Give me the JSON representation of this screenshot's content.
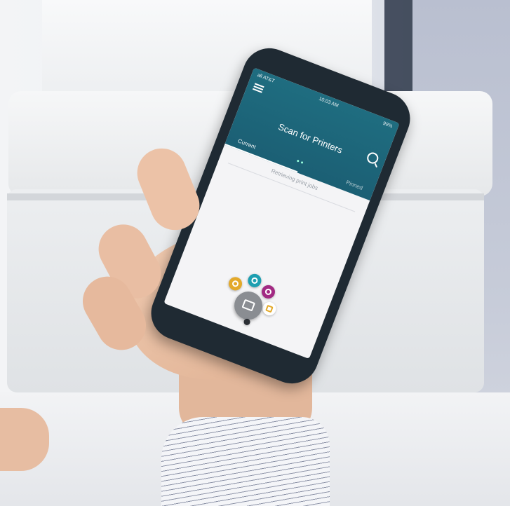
{
  "app": {
    "status": {
      "time": "10:03 AM",
      "battery": "99%",
      "signal": "all AT&T"
    },
    "title": "Scan for Printers",
    "tabs": [
      {
        "label": "Current"
      },
      {
        "label": "Pinned"
      }
    ],
    "notice": "Retrieving print jobs"
  },
  "colors": {
    "appbar": "#1f6d80",
    "fab_yellow": "#e3a92a",
    "fab_teal": "#1d9fb1",
    "fab_purple": "#a22a83"
  },
  "icons": {
    "menu": "hamburger-menu-icon",
    "search": "search-icon",
    "fab": "printer-icon"
  }
}
